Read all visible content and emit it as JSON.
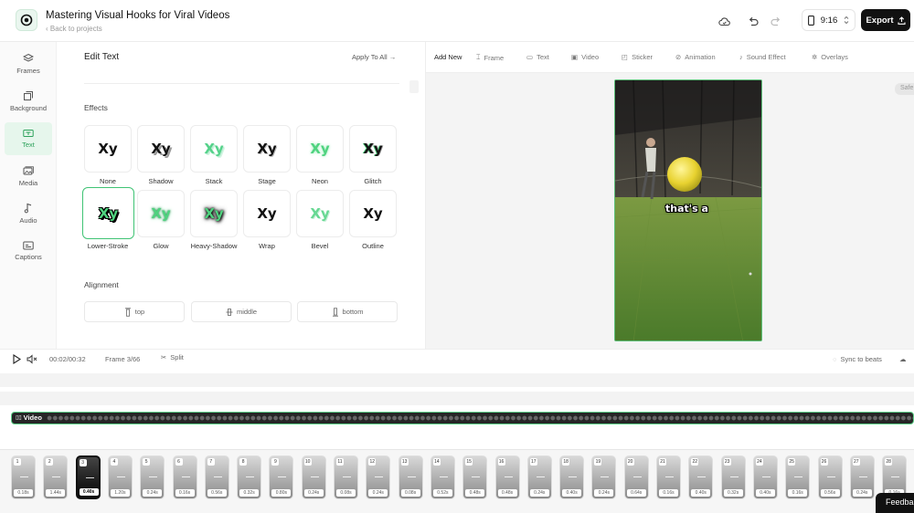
{
  "header": {
    "title": "Mastering Visual Hooks for Viral Videos",
    "back_label": "Back to projects",
    "ratio": "9:16",
    "export_label": "Export"
  },
  "sidebar": {
    "items": [
      {
        "label": "Frames",
        "icon": "layers-icon"
      },
      {
        "label": "Background",
        "icon": "background-icon"
      },
      {
        "label": "Text",
        "icon": "text-icon"
      },
      {
        "label": "Media",
        "icon": "media-icon"
      },
      {
        "label": "Audio",
        "icon": "music-icon"
      },
      {
        "label": "Captions",
        "icon": "captions-icon"
      }
    ],
    "active": "Text"
  },
  "edit_panel": {
    "title": "Edit Text",
    "apply_all": "Apply To All",
    "effects_label": "Effects",
    "effects": [
      {
        "label": "None",
        "sample": "Xy"
      },
      {
        "label": "Shadow",
        "sample": "Xy"
      },
      {
        "label": "Stack",
        "sample": "Xy"
      },
      {
        "label": "Stage",
        "sample": "Xy"
      },
      {
        "label": "Neon",
        "sample": "Xy"
      },
      {
        "label": "Glitch",
        "sample": "Xy"
      },
      {
        "label": "Lower-Stroke",
        "sample": "Xy"
      },
      {
        "label": "Glow",
        "sample": "Xy"
      },
      {
        "label": "Heavy-Shadow",
        "sample": "Xy"
      },
      {
        "label": "Wrap",
        "sample": "Xy"
      },
      {
        "label": "Bevel",
        "sample": "Xy"
      },
      {
        "label": "Outline",
        "sample": "Xy"
      }
    ],
    "selected_effect": "Lower-Stroke",
    "alignment_label": "Alignment",
    "alignment": [
      "top",
      "middle",
      "bottom"
    ]
  },
  "toolbar": {
    "add_new": "Add New",
    "items": [
      "Frame",
      "Text",
      "Video",
      "Sticker",
      "Animation",
      "Sound Effect",
      "Overlays"
    ]
  },
  "preview": {
    "safe_label": "Safe",
    "caption": "that's a"
  },
  "playback": {
    "time": "00:02/00:32",
    "frame": "Frame 3/66",
    "split_label": "Split",
    "sync_label": "Sync to beats"
  },
  "timeline": {
    "video_label": "Video",
    "selected_frame": 3,
    "frames": [
      {
        "n": "1",
        "dur": "0.18s"
      },
      {
        "n": "2",
        "dur": "1.44s"
      },
      {
        "n": "3",
        "dur": "0.40s"
      },
      {
        "n": "4",
        "dur": "1.20s"
      },
      {
        "n": "5",
        "dur": "0.24s"
      },
      {
        "n": "6",
        "dur": "0.16s"
      },
      {
        "n": "7",
        "dur": "0.56s"
      },
      {
        "n": "8",
        "dur": "0.32s"
      },
      {
        "n": "9",
        "dur": "0.80s"
      },
      {
        "n": "10",
        "dur": "0.24s"
      },
      {
        "n": "11",
        "dur": "0.08s"
      },
      {
        "n": "12",
        "dur": "0.24s"
      },
      {
        "n": "13",
        "dur": "0.08s"
      },
      {
        "n": "14",
        "dur": "0.52s"
      },
      {
        "n": "15",
        "dur": "0.48s"
      },
      {
        "n": "16",
        "dur": "0.48s"
      },
      {
        "n": "17",
        "dur": "0.24s"
      },
      {
        "n": "18",
        "dur": "0.40s"
      },
      {
        "n": "19",
        "dur": "0.24s"
      },
      {
        "n": "20",
        "dur": "0.64s"
      },
      {
        "n": "21",
        "dur": "0.16s"
      },
      {
        "n": "22",
        "dur": "0.40s"
      },
      {
        "n": "23",
        "dur": "0.32s"
      },
      {
        "n": "24",
        "dur": "0.40s"
      },
      {
        "n": "25",
        "dur": "0.16s"
      },
      {
        "n": "26",
        "dur": "0.56s"
      },
      {
        "n": "27",
        "dur": "0.24s"
      },
      {
        "n": "28",
        "dur": "0.16s"
      }
    ]
  },
  "feedback_label": "Feedba"
}
